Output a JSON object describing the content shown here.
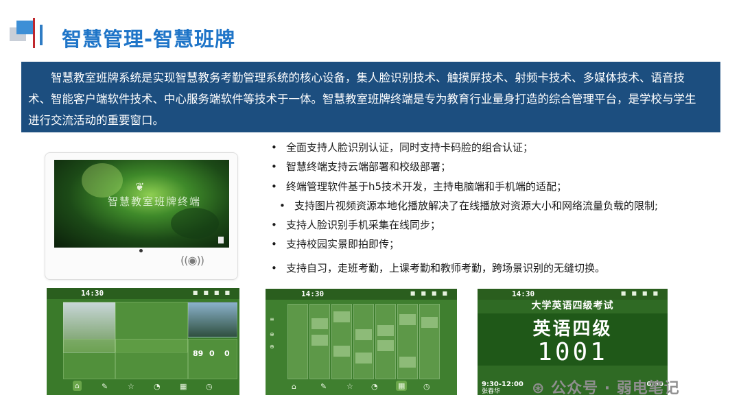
{
  "header": {
    "title": "智慧管理-智慧班牌"
  },
  "intro": {
    "text": "智慧教室班牌系统是实现智慧教务考勤管理系统的核心设备，集人脸识别技术、触摸屏技术、射频卡技术、多媒体技术、语音技术、智能客户端软件技术、中心服务端软件等技术于一体。智慧教室班牌终端是专为教育行业量身打造的综合管理平台，是学校与学生进行交流活动的重要窗口。"
  },
  "device": {
    "screen_brand": "智慧教室班牌终端"
  },
  "features": [
    "全面支持人脸识别认证，同时支持卡码脸的组合认证；",
    "智慧终端支持云端部署和校级部署；",
    "终端管理软件基于h5技术开发，主持电脑端和手机端的适配；",
    "支持图片视频资源本地化播放解决了在线播放对资源大小和网络流量负载的限制;",
    "支持人脸识别手机采集在线同步；",
    "支持校园实景即拍即传；",
    "支持自习，走班考勤，上课考勤和教师考勤，跨场景识别的无缝切换。"
  ],
  "panel1": {
    "time": "14:30",
    "counts": [
      "89",
      "0",
      "0"
    ]
  },
  "panel2": {
    "time": "14:30"
  },
  "panel3": {
    "time": "14:30",
    "exam_title": "大学英语四级考试",
    "subject": "英语四级",
    "room": "1001",
    "time_range": "9:30-12:00",
    "score": "0/50",
    "invigilator": "张春华"
  },
  "watermark": {
    "text": "公众号 · 弱电笔记"
  },
  "colors": {
    "title_blue": "#1f75c8",
    "intro_bg": "#1c4e7f",
    "accent_red": "#c0272d",
    "panel_green": "#3a7a2a"
  }
}
